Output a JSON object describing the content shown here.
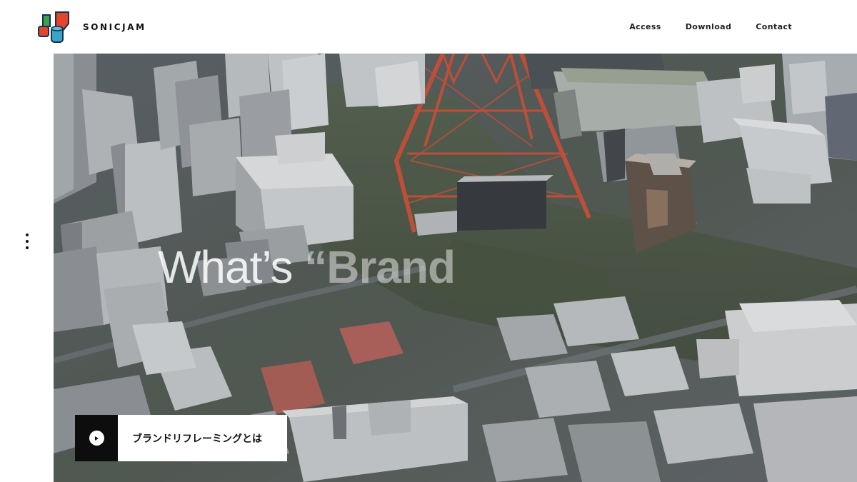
{
  "header": {
    "brand": "SONICJAM",
    "nav": [
      {
        "label": "Access"
      },
      {
        "label": "Download"
      },
      {
        "label": "Contact"
      }
    ]
  },
  "hero": {
    "headline_main": "What’s",
    "headline_faded": "“Brand",
    "cta_label": "ブランドリフレーミングとは"
  },
  "icons": {
    "logo": "sonicjam-logo-icon",
    "menu": "kebab-menu-icon",
    "play": "play-icon"
  },
  "colors": {
    "tower_red": "#c8472e",
    "cta_dark": "#0d0d0d",
    "logo_red": "#e2442c",
    "logo_teal": "#3ba3c6",
    "logo_green": "#3fa34d",
    "logo_navy": "#14304f"
  }
}
